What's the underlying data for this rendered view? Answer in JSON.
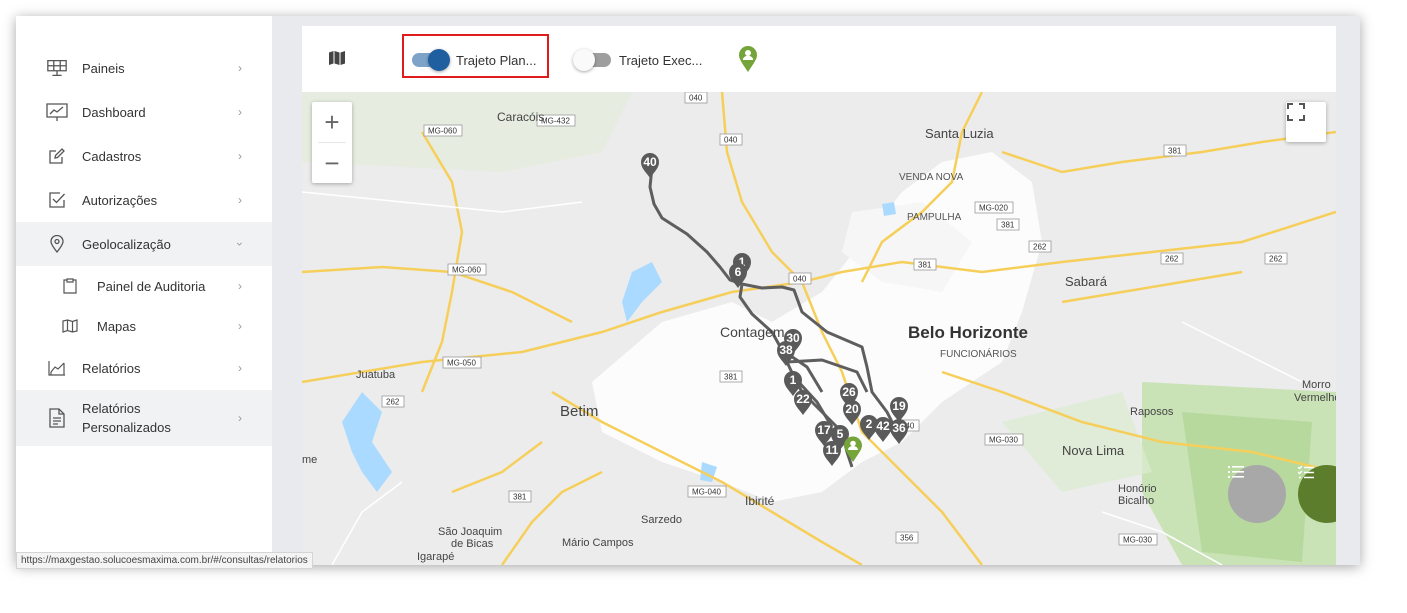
{
  "sidebar": {
    "items": [
      {
        "label": "Paineis",
        "icon": "solar-panel-icon"
      },
      {
        "label": "Dashboard",
        "icon": "presentation-chart-icon"
      },
      {
        "label": "Cadastros",
        "icon": "edit-icon"
      },
      {
        "label": "Autorizações",
        "icon": "checkbox-icon"
      },
      {
        "label": "Geolocalização",
        "icon": "location-pin-icon"
      },
      {
        "label": "Painel de Auditoria",
        "icon": "clipboard-icon"
      },
      {
        "label": "Mapas",
        "icon": "map-icon"
      },
      {
        "label": "Relatórios",
        "icon": "report-chart-icon"
      },
      {
        "label": "Relatórios Personalizados",
        "icon": "document-icon"
      }
    ]
  },
  "toolbar": {
    "map_icon": "map-icon",
    "toggle_planned": {
      "label": "Trajeto Plan...",
      "on": true
    },
    "toggle_executed": {
      "label": "Trajeto Exec...",
      "on": false
    },
    "user_pin_icon": "user-location-icon",
    "colors": {
      "toggle_on": "#1f5fa0",
      "highlight": "#e01b1b",
      "pin_green": "#74a43a"
    }
  },
  "map": {
    "zoom_in": "+",
    "zoom_out": "−",
    "labels": {
      "caracois": "Caracóis",
      "santa_luzia": "Santa Luzia",
      "venda_nova": "VENDA NOVA",
      "pampulha": "PAMPULHA",
      "contagem": "Contagem",
      "belo_horizonte": "Belo Horizonte",
      "funcionarios": "FUNCIONÁRIOS",
      "sabara": "Sabará",
      "juatuba": "Juatuba",
      "betim": "Betim",
      "raposos": "Raposos",
      "morro_vermelho_1": "Morro",
      "morro_vermelho_2": "Vermelho",
      "nova_lima": "Nova Lima",
      "honorio_1": "Honório",
      "honorio_2": "Bicalho",
      "ibirite": "Ibirité",
      "sarzedo": "Sarzedo",
      "sao_joaquim_1": "São Joaquim",
      "sao_joaquim_2": "de Bicas",
      "mario_campos": "Mário Campos",
      "igarape": "Igarapé",
      "me": "me"
    },
    "shields": {
      "mg060a": "MG-060",
      "mg432": "MG-432",
      "r040a": "040",
      "r040b": "040",
      "mg060b": "MG-060",
      "mg020": "MG-020",
      "r381a": "381",
      "r381b": "381",
      "r262a": "262",
      "r262b": "262",
      "r262c": "262",
      "r381c": "381",
      "r040c": "040",
      "mg050": "MG-050",
      "r381d": "381",
      "r262d": "262",
      "r040d": "040",
      "mg030a": "MG-030",
      "mg040": "MG-040",
      "r381e": "381",
      "r356": "356",
      "mg030b": "MG-030"
    },
    "markers": [
      "40",
      "1",
      "6",
      "30",
      "38",
      "1",
      "22",
      "26",
      "20",
      "17",
      "5",
      "2",
      "42",
      "36",
      "11",
      "19"
    ]
  },
  "fabs": {
    "list_icon": "list-icon",
    "checklist_icon": "checklist-icon",
    "colors": {
      "grey": "#a8a8a8",
      "green": "#5b7d2c"
    }
  },
  "status_bar": {
    "url": "https://maxgestao.solucoesmaxima.com.br/#/consultas/relatorios"
  }
}
